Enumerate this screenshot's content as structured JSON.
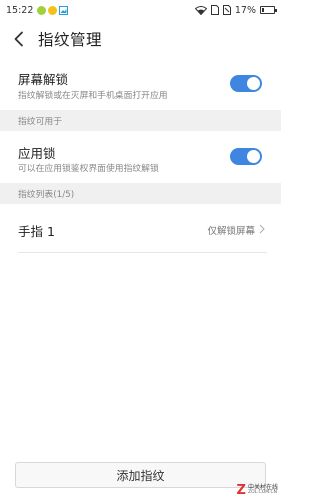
{
  "status_bar": {
    "time": "15:22",
    "battery": "17%",
    "battery_level": 0.17,
    "app_icons": [
      "green-app-icon",
      "yellow-app-icon",
      "image-icon"
    ],
    "system_icons": [
      "wifi-icon",
      "sim-card-icon",
      "no-signal-icon",
      "battery-icon"
    ]
  },
  "header": {
    "back_icon": "chevron-left-icon",
    "title": "指纹管理"
  },
  "screen_unlock": {
    "title": "屏幕解锁",
    "subtitle": "指纹解锁或在灭屏和手机桌面打开应用",
    "enabled": true
  },
  "section_usage": {
    "label": "指纹可用于"
  },
  "app_lock": {
    "title": "应用锁",
    "subtitle": "可以在应用锁鉴权界面使用指纹解锁",
    "enabled": true
  },
  "section_list": {
    "label": "指纹列表(1/5)"
  },
  "fingerprints": [
    {
      "name": "手指 1",
      "status": "仅解锁屏幕"
    }
  ],
  "add_button": {
    "label": "添加指纹"
  },
  "watermark": {
    "brand": "中关村在线",
    "url": "ZOL.COM.CN",
    "logo_letter": "Z"
  },
  "colors": {
    "accent": "#3f86e0",
    "section_bg": "#f0f0f0"
  }
}
